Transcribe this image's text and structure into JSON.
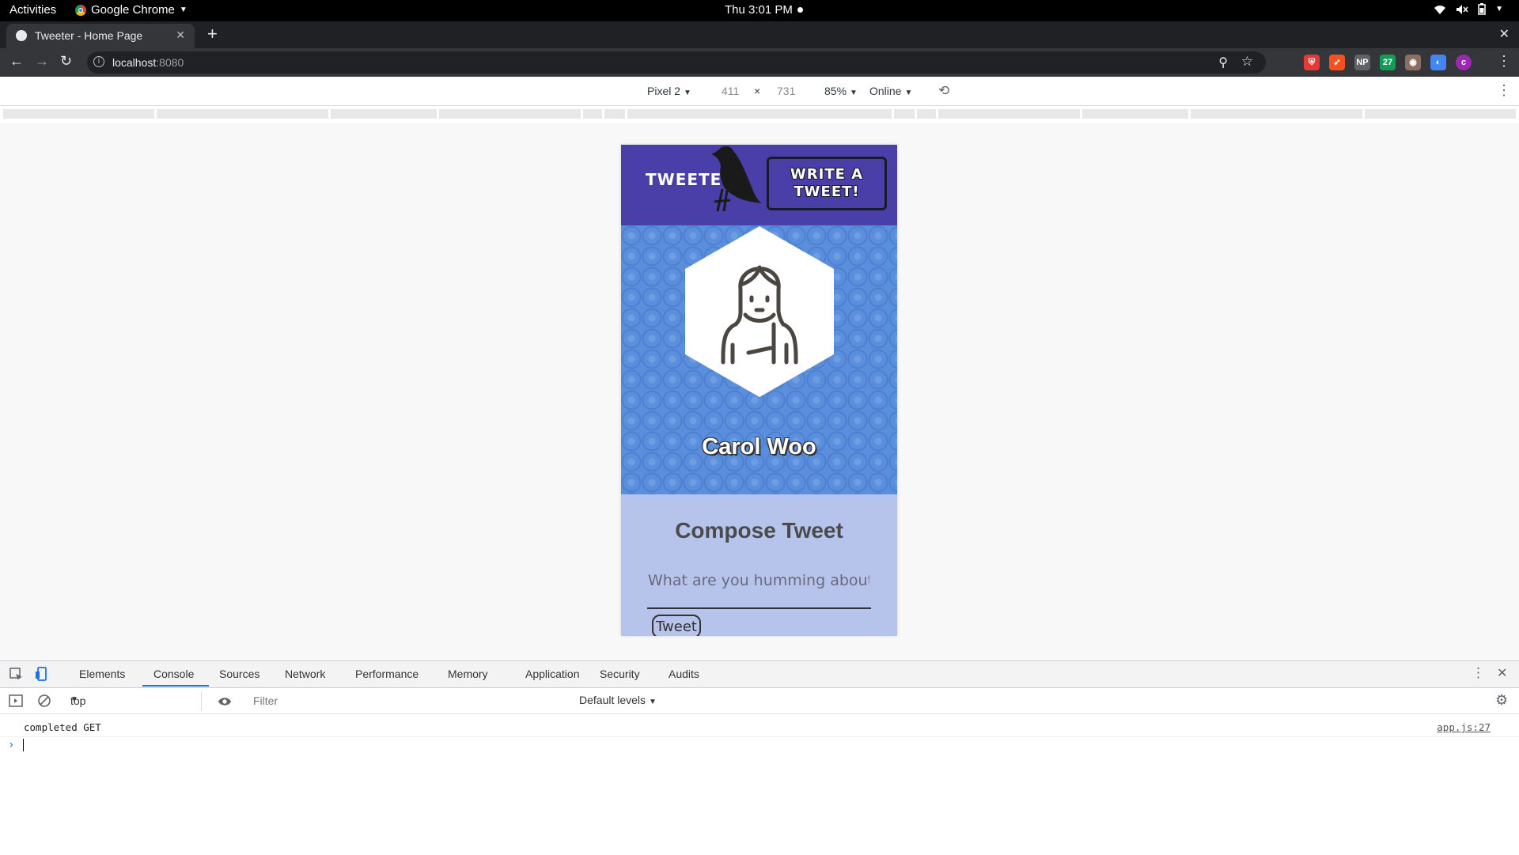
{
  "os": {
    "activities": "Activities",
    "app_name": "Google Chrome",
    "clock": "Thu  3:01 PM"
  },
  "browser": {
    "tab_title": "Tweeter - Home Page",
    "url_host": "localhost",
    "url_port": ":8080",
    "extensions": [
      {
        "name": "shield-ext",
        "color": "#e53935",
        "glyph": "⛨"
      },
      {
        "name": "arrow-ext",
        "color": "#f4511e",
        "glyph": "➹"
      },
      {
        "name": "np-ext",
        "color": "#5f6368",
        "glyph": "NP"
      },
      {
        "name": "calendar-ext",
        "color": "#0f9d58",
        "glyph": "27"
      },
      {
        "name": "owl-ext",
        "color": "#8d6e63",
        "glyph": "◉"
      },
      {
        "name": "circle-ext",
        "color": "#4285f4",
        "glyph": "◐"
      },
      {
        "name": "profile-avatar",
        "color": "#9c27b0",
        "glyph": "c"
      }
    ]
  },
  "devbar": {
    "device": "Pixel 2",
    "width": "411",
    "times": "×",
    "height": "731",
    "zoom": "85%",
    "network": "Online"
  },
  "page": {
    "brand": "TWEETER",
    "write_line1": "WRITE A",
    "write_line2": "TWEET!",
    "username": "Carol Woo",
    "compose_title": "Compose Tweet",
    "input_placeholder": "What are you humming about?",
    "tweet_button": "Tweet"
  },
  "devtools": {
    "tabs": [
      "Elements",
      "Console",
      "Sources",
      "Network",
      "Performance",
      "Memory",
      "Application",
      "Security",
      "Audits"
    ],
    "active_tab": "Console",
    "context": "top",
    "filter_placeholder": "Filter",
    "levels": "Default levels",
    "log_message": "completed GET",
    "log_source": "app.js:27"
  },
  "colors": {
    "nav_bg": "#4a3fa8",
    "profile_bg": "#5a8fde",
    "compose_bg": "#b6c3ea",
    "accent": "#1a73e8"
  }
}
